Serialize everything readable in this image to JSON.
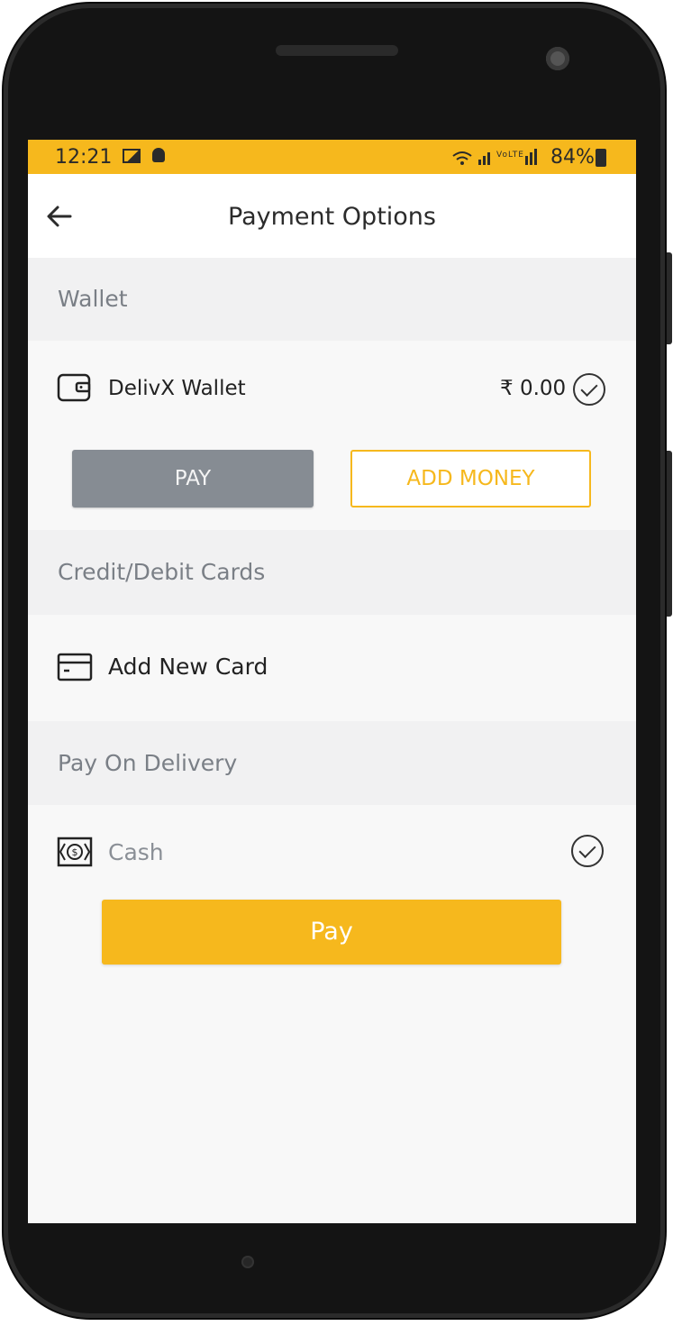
{
  "status_bar": {
    "time": "12:21",
    "signal_text": "Vo) R LTE2",
    "battery": "84%"
  },
  "app_bar": {
    "title": "Payment Options"
  },
  "wallet_section": {
    "header": "Wallet",
    "name": "DelivX Wallet",
    "balance": "₹ 0.00",
    "pay_label": "PAY",
    "add_money_label": "ADD MONEY"
  },
  "cards_section": {
    "header": "Credit/Debit Cards",
    "add_card_label": "Add New Card"
  },
  "delivery_section": {
    "header": "Pay On Delivery",
    "cash_label": "Cash"
  },
  "main_button": {
    "label": "Pay"
  },
  "colors": {
    "accent": "#f6b81d",
    "button_grey": "#868c93"
  }
}
